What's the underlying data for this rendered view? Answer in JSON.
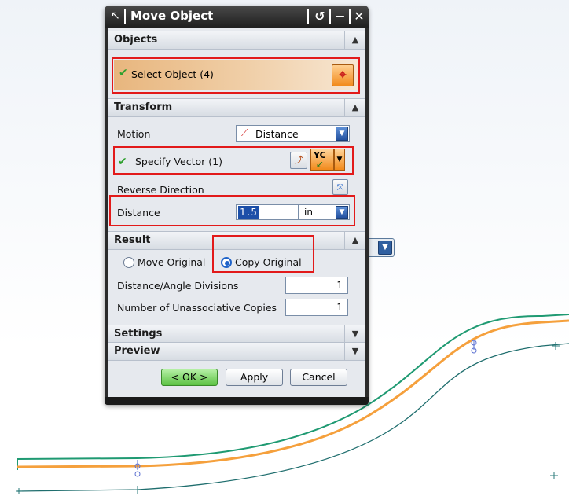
{
  "dialog": {
    "title": "Move Object",
    "objects": {
      "header": "Objects",
      "select_label": "Select Object (4)"
    },
    "transform": {
      "header": "Transform",
      "motion_label": "Motion",
      "motion_value": "Distance",
      "vector_label": "Specify Vector (1)",
      "vector_button": "YC",
      "reverse_label": "Reverse Direction",
      "distance_label": "Distance",
      "distance_value": "1.5",
      "distance_unit": "in"
    },
    "result": {
      "header": "Result",
      "move_original": "Move Original",
      "copy_original": "Copy Original",
      "divisions_label": "Distance/Angle Divisions",
      "divisions_value": "1",
      "copies_label": "Number of Unassociative Copies",
      "copies_value": "1"
    },
    "settings_header": "Settings",
    "preview_header": "Preview",
    "buttons": {
      "ok": "< OK >",
      "apply": "Apply",
      "cancel": "Cancel"
    }
  },
  "colors": {
    "green_curve": "#1f9a72",
    "orange_curve": "#f5a03c",
    "teal_curve": "#1f6e6e",
    "highlight_box": "#e21a1a"
  }
}
